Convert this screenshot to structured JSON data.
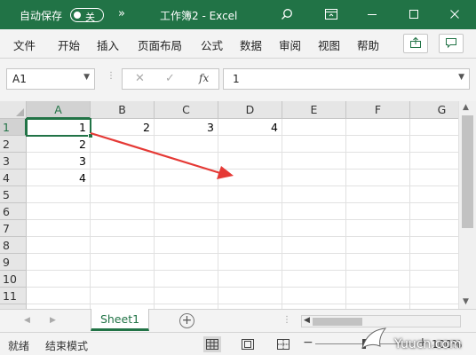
{
  "titlebar": {
    "autosave_label": "自动保存",
    "autosave_state": "关",
    "more_label": "»",
    "title": "工作簿2  -  Excel",
    "icons": [
      "search-icon",
      "ribbon-display-icon",
      "minimize-icon",
      "maximize-icon",
      "close-icon"
    ],
    "bg_color": "#217346"
  },
  "ribbon": {
    "tabs": [
      "文件",
      "开始",
      "插入",
      "页面布局",
      "公式",
      "数据",
      "审阅",
      "视图",
      "帮助"
    ],
    "right_icons": [
      "share-icon",
      "comment-icon"
    ]
  },
  "formula_bar": {
    "name_box": "A1",
    "cancel_symbol": "✕",
    "enter_symbol": "✓",
    "fx_label": "fx",
    "value": "1"
  },
  "grid": {
    "columns": [
      "A",
      "B",
      "C",
      "D",
      "E",
      "F",
      "G"
    ],
    "rows": [
      "1",
      "2",
      "3",
      "4",
      "5",
      "6",
      "7",
      "8",
      "9",
      "10",
      "11",
      "12"
    ],
    "selected_cell": "A1",
    "cells": {
      "a1": "1",
      "a2": "2",
      "a3": "3",
      "a4": "4",
      "b1": "2",
      "c1": "3",
      "d1": "4"
    },
    "annotation": "red-arrow-from-A1-pointing-right"
  },
  "sheets": {
    "tabs": [
      "Sheet1"
    ],
    "active": "Sheet1",
    "add_label": "+"
  },
  "statusbar": {
    "status": "就绪",
    "mode": "结束模式",
    "views": [
      "normal-view-icon",
      "page-layout-view-icon",
      "page-break-view-icon"
    ],
    "zoom_minus": "−",
    "zoom_plus": "+",
    "zoom_level": "100%",
    "zoom_fraction": 0.5
  },
  "watermark": {
    "text": "Yuucn.com"
  }
}
